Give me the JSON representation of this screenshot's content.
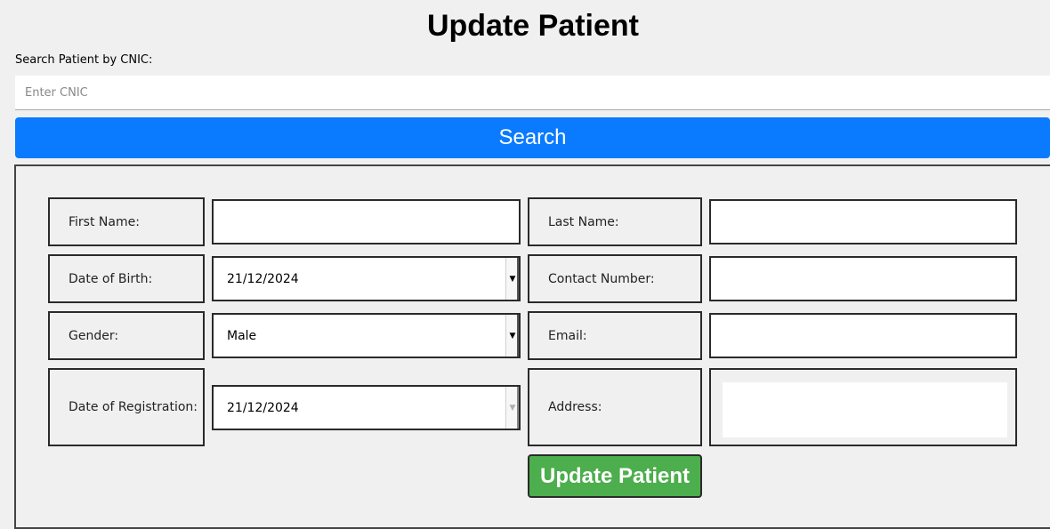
{
  "page_title": "Update Patient",
  "search": {
    "label": "Search Patient by CNIC:",
    "placeholder": "Enter CNIC",
    "value": "",
    "button_label": "Search"
  },
  "form": {
    "first_name": {
      "label": "First Name:",
      "value": ""
    },
    "last_name": {
      "label": "Last Name:",
      "value": ""
    },
    "date_of_birth": {
      "label": "Date of Birth:",
      "value": "21/12/2024"
    },
    "contact_number": {
      "label": "Contact Number:",
      "value": ""
    },
    "gender": {
      "label": "Gender:",
      "value": "Male"
    },
    "email": {
      "label": "Email:",
      "value": ""
    },
    "date_of_registration": {
      "label": "Date of Registration:",
      "value": "21/12/2024"
    },
    "address": {
      "label": "Address:",
      "value": ""
    },
    "submit_label": "Update Patient"
  },
  "colors": {
    "background": "#f0f0f0",
    "search_button": "#0a7bff",
    "update_button": "#4cae4c",
    "border": "#2a2a2a"
  },
  "icons": {
    "dropdown": "chevron-down-icon"
  }
}
